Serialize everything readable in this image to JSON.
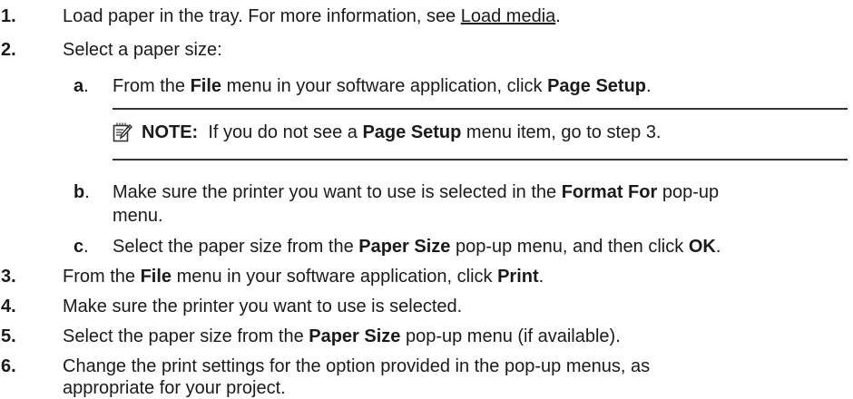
{
  "steps": [
    {
      "number": "1.",
      "before": "Load paper in the tray. For more information, see ",
      "link": "Load media",
      "after": "."
    },
    {
      "number": "2.",
      "text": "Select a paper size:",
      "substeps": [
        {
          "letter": "a",
          "letter_suffix": ".",
          "parts": [
            "From the ",
            "File",
            " menu in your software application, click ",
            "Page Setup",
            "."
          ]
        },
        {
          "letter": "b",
          "letter_suffix": ".",
          "line1_parts": [
            "Make sure the printer you want to use is selected in the ",
            "Format For",
            " pop-up"
          ],
          "line2": "menu."
        },
        {
          "letter": "c",
          "letter_suffix": ".",
          "parts": [
            "Select the paper size from the ",
            "Paper Size",
            " pop-up menu, and then click ",
            "OK",
            "."
          ]
        }
      ],
      "note": {
        "icon": "note-pencil-icon",
        "label": "NOTE:",
        "parts": [
          "  If you do not see a ",
          "Page Setup",
          " menu item, go to step 3."
        ]
      }
    },
    {
      "number": "3.",
      "parts": [
        "From the ",
        "File",
        " menu in your software application, click ",
        "Print",
        "."
      ]
    },
    {
      "number": "4.",
      "text": "Make sure the printer you want to use is selected."
    },
    {
      "number": "5.",
      "parts": [
        "Select the paper size from the ",
        "Paper Size",
        " pop-up menu (if available)."
      ]
    },
    {
      "number": "6.",
      "line1": "Change the print settings for the option provided in the pop-up menus, as",
      "line2": "appropriate for your project."
    }
  ],
  "colors": {
    "text": "#1a1a1a",
    "rule": "#333333"
  }
}
